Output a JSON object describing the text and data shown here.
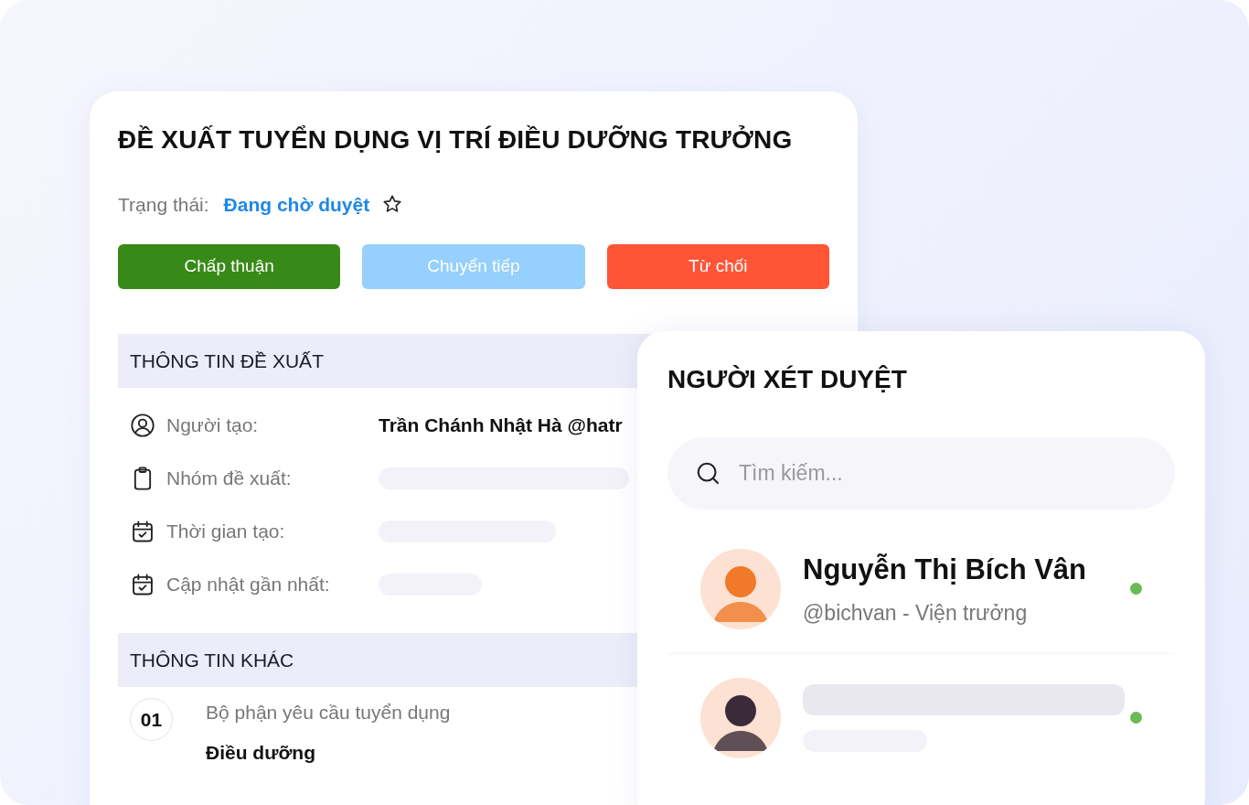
{
  "proposal": {
    "title": "ĐỀ XUẤT TUYỂN DỤNG VỊ TRÍ ĐIỀU DƯỠNG TRƯỞNG",
    "status_label": "Trạng thái:",
    "status": "Đang chờ duyệt",
    "starred": false,
    "buttons": [
      {
        "label": "Chấp thuận",
        "kind": "approve",
        "disabled": false
      },
      {
        "label": "Chuyển tiếp",
        "kind": "forward",
        "disabled": true
      },
      {
        "label": "Từ chối",
        "kind": "reject",
        "disabled": false
      }
    ],
    "sections": [
      {
        "title": "THÔNG TIN ĐỀ XUẤT",
        "kind": "fields",
        "rows": [
          {
            "kind": "user",
            "label": "Người tạo:",
            "value": "Trần Chánh Nhật Hà @hatr"
          },
          {
            "kind": "clipboard",
            "label": "Nhóm đề xuất:"
          },
          {
            "kind": "date",
            "label": "Thời gian tạo:"
          },
          {
            "kind": "date",
            "label": "Cập nhật gần nhất:"
          }
        ]
      },
      {
        "title": "THÔNG TIN KHÁC",
        "kind": "numbered",
        "rows": [
          {
            "number": "01",
            "label": "Bộ phận yêu cầu tuyển dụng",
            "value": "Điều dưỡng"
          }
        ]
      }
    ]
  },
  "reviewers": {
    "title": "NGƯỜI XÉT DUYỆT",
    "search": {
      "placeholder": "Tìm kiếm..."
    },
    "items": [
      {
        "name": "Nguyễn Thị Bích Vân",
        "subtitle": "@bichvan - Viện trưởng",
        "online": true
      },
      {
        "online": true
      }
    ]
  }
}
